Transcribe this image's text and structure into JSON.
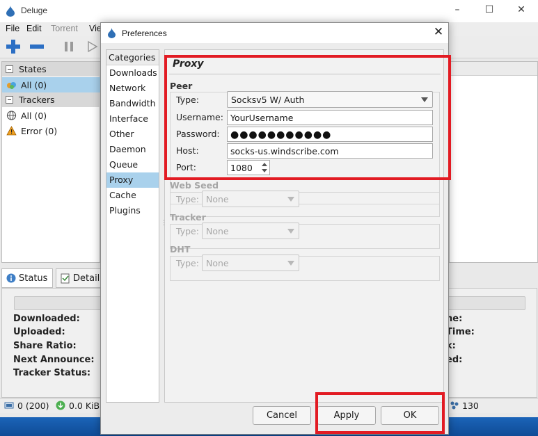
{
  "main_window": {
    "title": "Deluge",
    "menu": [
      "File",
      "Edit",
      "Torrent",
      "Vie"
    ],
    "sidebar": {
      "states_header": "States",
      "states_items": [
        {
          "label": "All (0)"
        }
      ],
      "trackers_header": "Trackers",
      "trackers_items": [
        {
          "label": "All (0)"
        },
        {
          "label": "Error (0)"
        }
      ]
    },
    "bottom_tabs": [
      "Status",
      "Detail"
    ],
    "info_labels": [
      "Downloaded:",
      "Uploaded:",
      "Share Ratio:",
      "Next Announce:",
      "Tracker Status:"
    ],
    "info_right_labels": [
      "ne:",
      "Time:",
      "k:",
      "ed:"
    ],
    "status_bar": {
      "connections": "0 (200)",
      "download": "0.0 KiB",
      "dht_nodes": "130"
    }
  },
  "dialog": {
    "title": "Preferences",
    "categories_header": "Categories",
    "categories": [
      "Downloads",
      "Network",
      "Bandwidth",
      "Interface",
      "Other",
      "Daemon",
      "Queue",
      "Proxy",
      "Cache",
      "Plugins"
    ],
    "selected_category": "Proxy",
    "heading": "Proxy",
    "peer": {
      "title": "Peer",
      "type_label": "Type:",
      "type_value": "Socksv5 W/ Auth",
      "username_label": "Username:",
      "username_value": "YourUsername",
      "password_label": "Password:",
      "password_dots": "●●●●●●●●●●●",
      "host_label": "Host:",
      "host_value": "socks-us.windscribe.com",
      "port_label": "Port:",
      "port_value": "1080"
    },
    "web_seed": {
      "title": "Web Seed",
      "type_label": "Type:",
      "type_value": "None"
    },
    "tracker": {
      "title": "Tracker",
      "type_label": "Type:",
      "type_value": "None"
    },
    "dht": {
      "title": "DHT",
      "type_label": "Type:",
      "type_value": "None"
    },
    "buttons": {
      "cancel": "Cancel",
      "apply": "Apply",
      "ok": "OK"
    }
  },
  "colors": {
    "highlight_annotation": "#e21b23",
    "selection": "#a9d1ec",
    "desktop": "#1a5aa0"
  }
}
